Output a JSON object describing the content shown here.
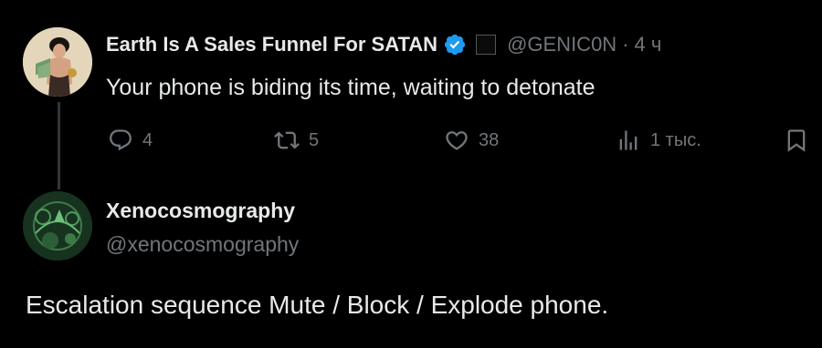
{
  "parent_tweet": {
    "author_name": "Earth Is A Sales Funnel For SATAN",
    "author_handle": "@GENIC0N",
    "separator": "·",
    "timestamp": "4 ч",
    "text": "Your phone is biding its time, waiting to detonate",
    "reply_count": "4",
    "retweet_count": "5",
    "like_count": "38",
    "view_count": "1 тыс."
  },
  "reply_tweet": {
    "author_name": "Xenocosmography",
    "author_handle": "@xenocosmography",
    "text": "Escalation sequence Mute / Block / Explode phone."
  },
  "icons": {
    "verified": "verified-badge-icon",
    "affiliate": "affiliate-badge-icon",
    "reply": "reply-icon",
    "retweet": "retweet-icon",
    "like": "like-icon",
    "views": "views-icon",
    "bookmark": "bookmark-icon"
  },
  "colors": {
    "background": "#000000",
    "text_primary": "#e7e9ea",
    "text_secondary": "#71767b",
    "verified_blue": "#1d9bf0",
    "thread_line": "#333639"
  }
}
